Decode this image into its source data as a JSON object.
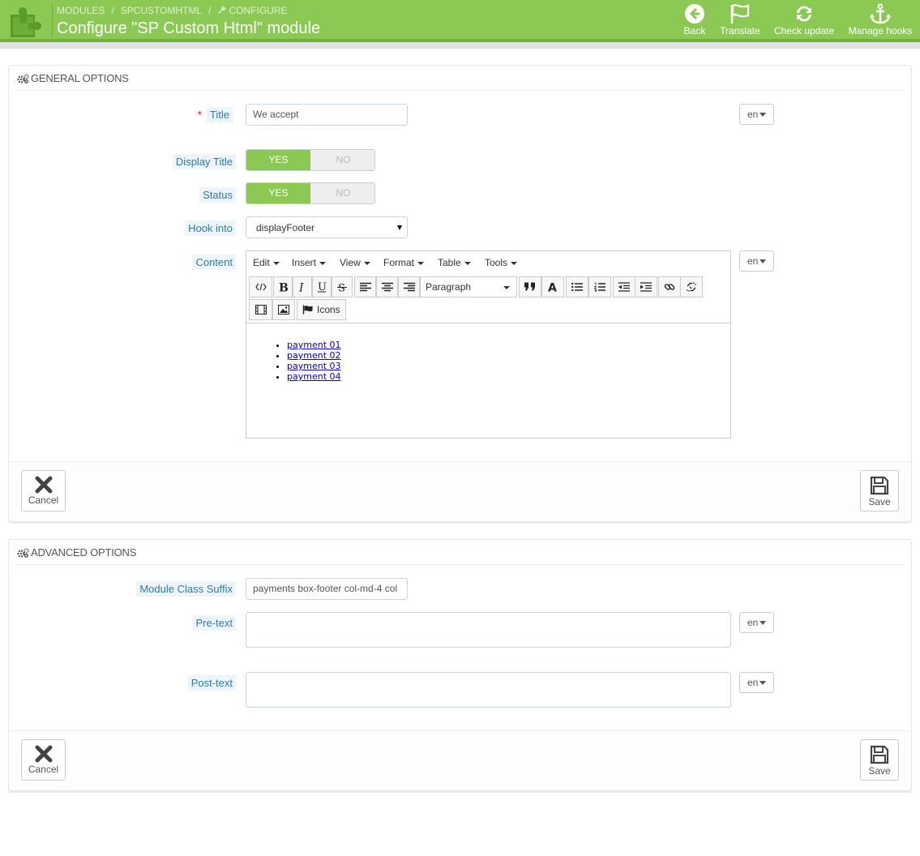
{
  "header": {
    "breadcrumb": [
      "MODULES",
      "SPCUSTOMHTML",
      "CONFIGURE"
    ],
    "title": "Configure \"SP Custom Html\" module",
    "actions": [
      {
        "label": "Back",
        "icon": "back-circle-icon"
      },
      {
        "label": "Translate",
        "icon": "flag-icon"
      },
      {
        "label": "Check update",
        "icon": "refresh-icon"
      },
      {
        "label": "Manage hooks",
        "icon": "anchor-icon"
      }
    ],
    "accent": "#8bc954"
  },
  "general": {
    "heading": "GENERAL OPTIONS",
    "title_label": "Title",
    "title_required": "*",
    "title_value": "We accept",
    "lang": "en",
    "display_title_label": "Display Title",
    "status_label": "Status",
    "yes": "YES",
    "no": "NO",
    "hook_label": "Hook into",
    "hook_value": "displayFooter",
    "content_label": "Content",
    "editor": {
      "menus": [
        "Edit",
        "Insert",
        "View",
        "Format",
        "Table",
        "Tools"
      ],
      "block_format": "Paragraph",
      "icons_label": "Icons",
      "items": [
        "payment 01",
        "payment 02",
        "payment 03",
        "payment 04"
      ]
    },
    "cancel": "Cancel",
    "save": "Save"
  },
  "advanced": {
    "heading": "ADVANCED OPTIONS",
    "suffix_label": "Module Class Suffix",
    "suffix_value": "payments box-footer col-md-4 col",
    "pretext_label": "Pre-text",
    "posttext_label": "Post-text",
    "lang": "en",
    "cancel": "Cancel",
    "save": "Save"
  }
}
